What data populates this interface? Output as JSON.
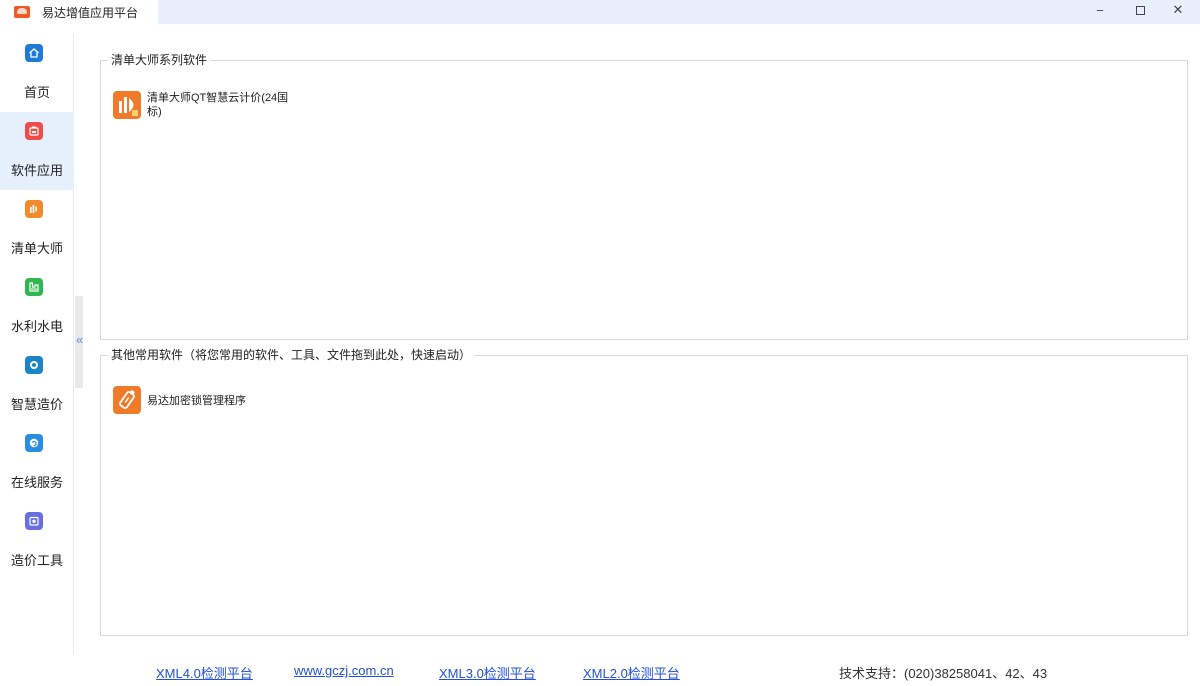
{
  "window": {
    "title": "易达增值应用平台",
    "controls": {
      "minimize": "−",
      "close": "✕"
    }
  },
  "sidebar": {
    "items": [
      {
        "label": "首页",
        "icon": "home-icon",
        "color": "#1e7bd8"
      },
      {
        "label": "软件应用",
        "icon": "software-app-icon",
        "color": "#ee4b4b"
      },
      {
        "label": "清单大师",
        "icon": "qingdan-master-icon",
        "color": "#f28a2c"
      },
      {
        "label": "水利水电",
        "icon": "hydropower-icon",
        "color": "#2fb84f"
      },
      {
        "label": "智慧造价",
        "icon": "smart-cost-icon",
        "color": "#1a86c8"
      },
      {
        "label": "在线服务",
        "icon": "online-service-icon",
        "color": "#2a8ee0"
      },
      {
        "label": "造价工具",
        "icon": "cost-tools-icon",
        "color": "#6a6fe0"
      }
    ],
    "active_index": 1
  },
  "groups": [
    {
      "title": "清单大师系列软件",
      "apps": [
        {
          "name": "清单大师QT智慧云计价(24国标)",
          "icon": "qingdan-qt-app-icon",
          "color": "#f07a2a"
        }
      ]
    },
    {
      "title": "其他常用软件（将您常用的软件、工具、文件拖到此处，快速启动）",
      "apps": [
        {
          "name": "易达加密锁管理程序",
          "icon": "encryption-lock-app-icon",
          "color": "#f07a2a"
        }
      ]
    }
  ],
  "footer": {
    "links": [
      "XML4.0检测平台",
      "www.gczj.com.cn",
      "XML3.0检测平台",
      "XML2.0检测平台"
    ],
    "support": "技术支持：(020)38258041、42、43"
  }
}
